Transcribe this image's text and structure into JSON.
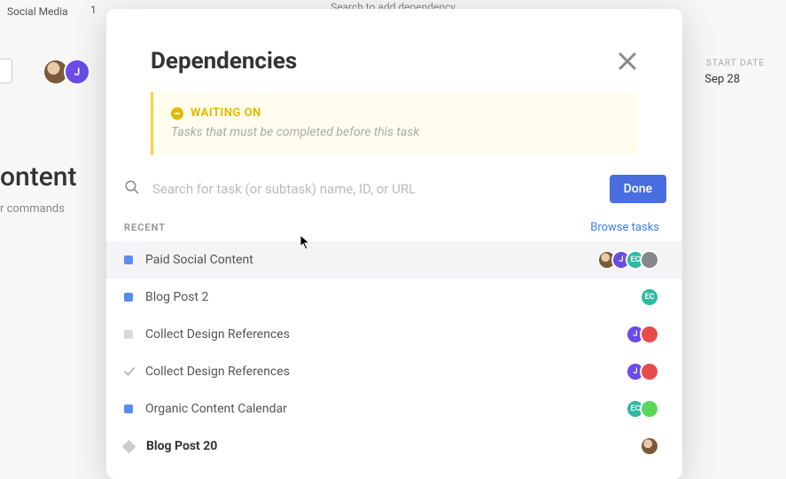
{
  "bg": {
    "search_hint": "Search to add dependency",
    "tab_label": "Social Media",
    "tab_count": "1",
    "start_date_label": "START DATE",
    "start_date": "Sep 28",
    "title_fragment": "ontent",
    "commands_fragment": "r commands"
  },
  "modal": {
    "title": "Dependencies",
    "waiting_on": {
      "label": "WAITING ON",
      "subtitle": "Tasks that must be completed before this task"
    },
    "search": {
      "placeholder": "Search for task (or subtask) name, ID, or URL",
      "done_label": "Done"
    },
    "recent_label": "RECENT",
    "browse_label": "Browse tasks",
    "tasks": [
      {
        "name": "Paid Social Content",
        "status_color": "#5b8def",
        "status": "square",
        "bold": false,
        "hovered": true
      },
      {
        "name": "Blog Post 2",
        "status_color": "#5b8def",
        "status": "square",
        "bold": false,
        "hovered": false
      },
      {
        "name": "Collect Design References",
        "status_color": "#d9d9d9",
        "status": "square",
        "bold": false,
        "hovered": false
      },
      {
        "name": "Collect Design References",
        "status_color": "",
        "status": "check",
        "bold": false,
        "hovered": false
      },
      {
        "name": "Organic Content Calendar",
        "status_color": "#5b8def",
        "status": "square",
        "bold": false,
        "hovered": false
      },
      {
        "name": "Blog Post 20",
        "status_color": "",
        "status": "diamond",
        "bold": true,
        "hovered": false
      }
    ],
    "task_assignees": [
      [
        {
          "cls": "photo",
          "txt": ""
        },
        {
          "cls": "purple",
          "txt": "J"
        },
        {
          "cls": "teal",
          "txt": "EC"
        },
        {
          "cls": "grey",
          "txt": ""
        }
      ],
      [
        {
          "cls": "teal",
          "txt": "EC"
        }
      ],
      [
        {
          "cls": "purple",
          "txt": "J"
        },
        {
          "cls": "red",
          "txt": ""
        }
      ],
      [
        {
          "cls": "purple",
          "txt": "J"
        },
        {
          "cls": "red",
          "txt": ""
        }
      ],
      [
        {
          "cls": "teal",
          "txt": "EC"
        },
        {
          "cls": "green",
          "txt": ""
        }
      ],
      [
        {
          "cls": "photo",
          "txt": ""
        }
      ]
    ]
  }
}
